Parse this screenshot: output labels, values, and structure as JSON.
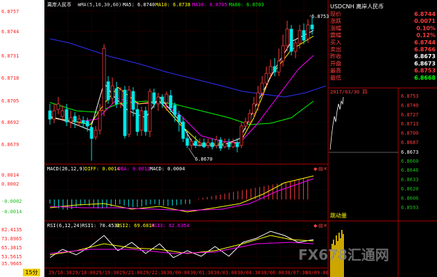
{
  "chart_header": {
    "symbol_name": "离岸人民币",
    "settings": "⊠MA(5,10,30,60)",
    "ma5": "MA5: 6.8740",
    "ma10": "MA10: 6.8738",
    "ma30": "MA30: 6.8705",
    "ma60": "MA60: 6.8703"
  },
  "colors": {
    "background": "#000000",
    "up_candle": "#ff3b3b",
    "down_candle": "#00e6e6",
    "ma5": "#ffffff",
    "ma10": "#ffff00",
    "ma30": "#ff00ff",
    "ma60": "#00ff00",
    "ma_long": "#3030ff",
    "grid": "#7a0000",
    "axis_text": "#ff4040"
  },
  "price_axis": [
    "6.8757",
    "6.8744",
    "6.8731",
    "6.8718",
    "6.8705",
    "6.8692",
    "6.8679"
  ],
  "price_annotations": {
    "high": "6.8753",
    "low": "6.8670"
  },
  "macd": {
    "title": "MACD(26,12,9)",
    "diff": "DIFF: 0.0014",
    "dea": "DEA: 0.0012",
    "macd": "MACD: 0.0004",
    "axis": [
      "0.0014",
      "0.0002",
      "-0.0002",
      "-0.0014"
    ]
  },
  "rsi": {
    "title": "RSI(6,12,24)",
    "rsi1": "RSI1: 70.4532",
    "rsi2": "RSI2: 69.6814",
    "rsi3": "RSI3: 62.6354",
    "axis": [
      "82.4135",
      "73.8965",
      "65.3815",
      "53.5615",
      "35.9665"
    ]
  },
  "time_axis": [
    "29/16:30",
    "29/18:00",
    "29/19:30",
    "29/21:00",
    "29/22:30",
    "30/00:00",
    "30/01:30",
    "30/03:00",
    "30/04:30",
    "30/06:00",
    "30/07:30",
    "30/09:00"
  ],
  "period": "15分",
  "quote_panel": {
    "title": "USDCNH 离岸人民币",
    "rows": [
      {
        "label": "现价",
        "value": "6.8744",
        "color": "#ff3b3b"
      },
      {
        "label": "涨跌",
        "value": "0.0071",
        "color": "#ff3b3b"
      },
      {
        "label": "涨幅",
        "value": "0.10%",
        "color": "#ff3b3b"
      },
      {
        "label": "震幅",
        "value": "0.12%",
        "color": "#ff3b3b"
      },
      {
        "label": "买入",
        "value": "6.8744",
        "color": "#ff3b3b"
      },
      {
        "label": "卖出",
        "value": "6.8766",
        "color": "#ff3b3b"
      },
      {
        "label": "昨收",
        "value": "6.8673",
        "color": "#ffffff"
      },
      {
        "label": "开盘",
        "value": "6.8673",
        "color": "#ffffff"
      },
      {
        "label": "最高",
        "value": "6.8753",
        "color": "#ff3b3b"
      },
      {
        "label": "最低",
        "value": "6.8668",
        "color": "#00ff00"
      }
    ]
  },
  "mini_chart": {
    "date": "2017/03/30 四",
    "axis": [
      "6.8753",
      "6.8740",
      "6.8727",
      "6.8713",
      "6.8700",
      "6.8687",
      "6.8673",
      "6.8660",
      "6.8646",
      "6.8633",
      "6.8620",
      "6.8606",
      "6.8593"
    ],
    "ref_label": "6.8673",
    "volume_label": "跳动量"
  },
  "watermark": "FX678汇通网"
}
